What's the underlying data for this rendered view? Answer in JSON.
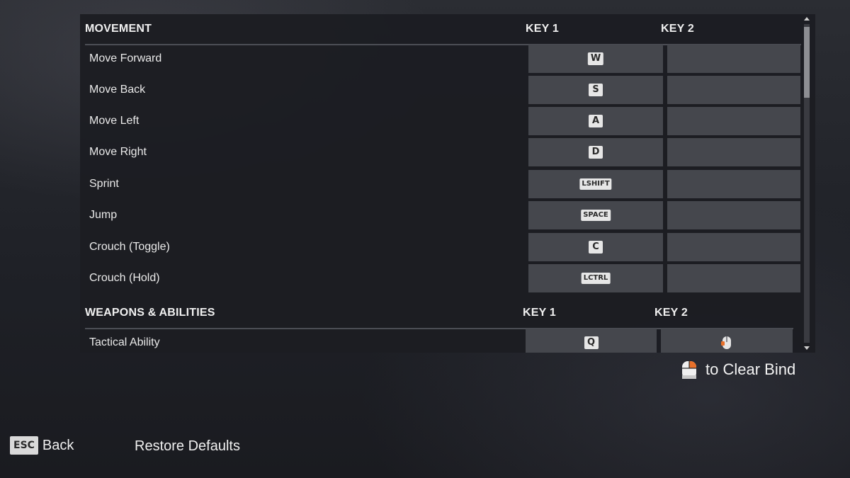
{
  "sections": [
    {
      "title": "MOVEMENT",
      "key1_label": "KEY 1",
      "key2_label": "KEY 2",
      "rows": [
        {
          "label": "Move Forward",
          "key1": "W",
          "key2": ""
        },
        {
          "label": "Move Back",
          "key1": "S",
          "key2": ""
        },
        {
          "label": "Move Left",
          "key1": "A",
          "key2": ""
        },
        {
          "label": "Move Right",
          "key1": "D",
          "key2": ""
        },
        {
          "label": "Sprint",
          "key1": "LSHIFT",
          "key2": ""
        },
        {
          "label": "Jump",
          "key1": "SPACE",
          "key2": ""
        },
        {
          "label": "Crouch (Toggle)",
          "key1": "C",
          "key2": ""
        },
        {
          "label": "Crouch (Hold)",
          "key1": "LCTRL",
          "key2": ""
        }
      ]
    },
    {
      "title": "WEAPONS & ABILITIES",
      "key1_label": "KEY 1",
      "key2_label": "KEY 2",
      "rows": [
        {
          "label": "Tactical Ability",
          "key1": "Q",
          "key2_icon": "mouse-side-button-icon"
        }
      ]
    }
  ],
  "clear_hint": {
    "icon": "mouse-right-click-icon",
    "text": "to Clear Bind"
  },
  "footer": {
    "back_key": "ESC",
    "back_label": "Back",
    "restore_label": "Restore Defaults"
  },
  "colors": {
    "accent": "#e8702a",
    "slot": "#45474d",
    "panel": "#1c1d22"
  }
}
